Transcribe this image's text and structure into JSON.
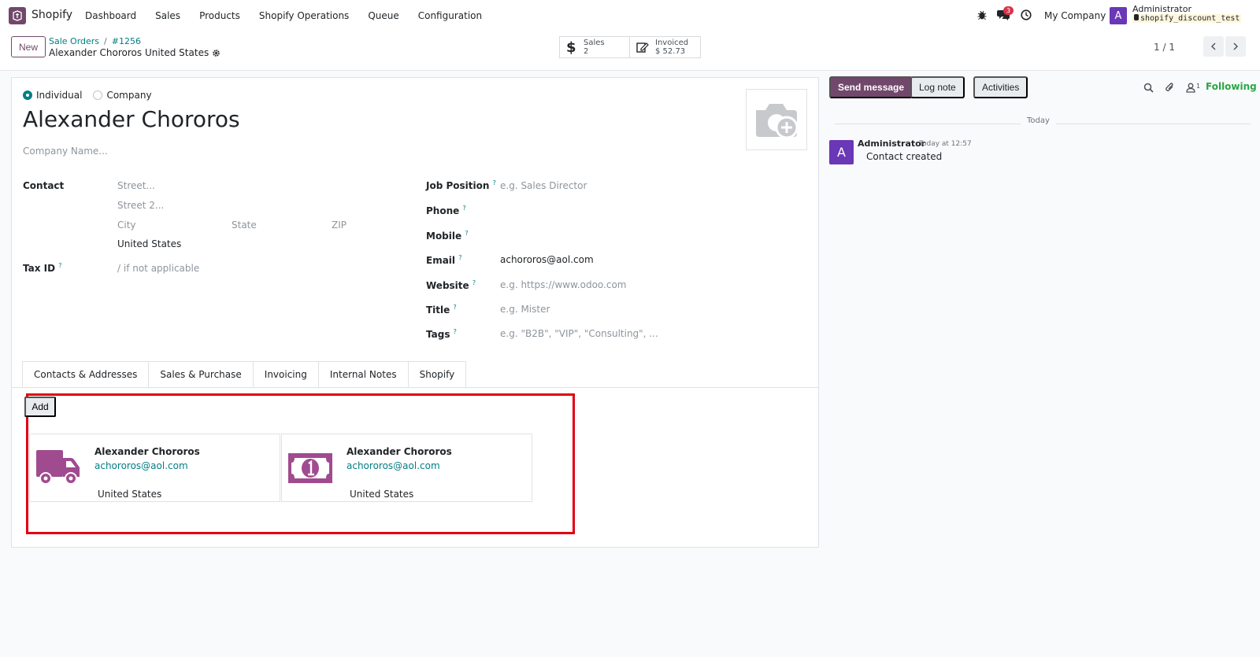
{
  "navbar": {
    "app_name": "Shopify",
    "menu": [
      "Dashboard",
      "Sales",
      "Products",
      "Shopify Operations",
      "Queue",
      "Configuration"
    ],
    "chat_badge": "3",
    "company": "My Company",
    "user_initial": "A",
    "user_name": "Administrator",
    "db_name": "shopify_discount_test"
  },
  "control": {
    "new_label": "New",
    "breadcrumb_parent": "Sale Orders",
    "breadcrumb_sep": "/",
    "breadcrumb_record": "#1256",
    "current_title": "Alexander Chororos United States",
    "stats": [
      {
        "label": "Sales",
        "value": "2"
      },
      {
        "label": "Invoiced",
        "value": "$ 52.73"
      }
    ],
    "pager": "1 / 1"
  },
  "form": {
    "radio_individual": "Individual",
    "radio_company": "Company",
    "name": "Alexander Chororos",
    "company_placeholder": "Company Name...",
    "contact_label": "Contact",
    "street_ph": "Street...",
    "street2_ph": "Street 2...",
    "city_ph": "City",
    "state_ph": "State",
    "zip_ph": "ZIP",
    "country": "United States",
    "taxid_label": "Tax ID",
    "taxid_ph": "/ if not applicable",
    "help_mark": "?",
    "job_label": "Job Position",
    "job_ph": "e.g. Sales Director",
    "phone_label": "Phone",
    "mobile_label": "Mobile",
    "email_label": "Email",
    "email": "achororos@aol.com",
    "website_label": "Website",
    "website_ph": "e.g. https://www.odoo.com",
    "title_label": "Title",
    "title_ph": "e.g. Mister",
    "tags_label": "Tags",
    "tags_ph": "e.g. \"B2B\", \"VIP\", \"Consulting\", ..."
  },
  "tabs": [
    "Contacts & Addresses",
    "Sales & Purchase",
    "Invoicing",
    "Internal Notes",
    "Shopify"
  ],
  "contacts": {
    "add_label": "Add",
    "cards": [
      {
        "name": "Alexander Chororos",
        "email": "achororos@aol.com",
        "country": "United States",
        "icon": "truck-icon"
      },
      {
        "name": "Alexander Chororos",
        "email": "achororos@aol.com",
        "country": "United States",
        "icon": "money-icon"
      }
    ]
  },
  "chatter": {
    "send_label": "Send message",
    "log_label": "Log note",
    "activities_label": "Activities",
    "followers_count": "1",
    "following_label": "Following",
    "date_label": "Today",
    "message": {
      "initial": "A",
      "author": "Administrator",
      "time": "Today at 12:57",
      "body": "Contact created"
    }
  },
  "colors": {
    "brand": "#71486b",
    "link": "#017e84",
    "highlight": "#e10010",
    "following": "#28a745"
  }
}
